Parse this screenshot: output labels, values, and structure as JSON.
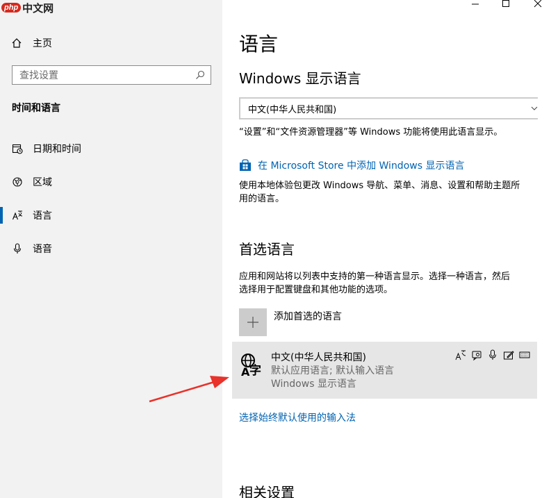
{
  "watermark": {
    "badge": "php",
    "text": "中文网"
  },
  "sidebar": {
    "home": "主页",
    "search_placeholder": "查找设置",
    "section_title": "时间和语言",
    "items": [
      {
        "label": "日期和时间",
        "icon": "calendar-clock-icon"
      },
      {
        "label": "区域",
        "icon": "globe-region-icon"
      },
      {
        "label": "语言",
        "icon": "language-icon",
        "active": true
      },
      {
        "label": "语音",
        "icon": "microphone-icon"
      }
    ]
  },
  "window_controls": [
    "minimize",
    "maximize",
    "close"
  ],
  "main": {
    "title": "语言",
    "display_language": {
      "heading": "Windows 显示语言",
      "selected": "中文(中华人民共和国)",
      "description": "“设置”和“文件资源管理器”等 Windows 功能将使用此语言显示。",
      "store_link": "在 Microsoft Store 中添加 Windows 显示语言",
      "store_description_line1": "使用本地体验包更改 Windows 导航、菜单、消息、设置和帮助主题所",
      "store_description_line2": "用的语言。"
    },
    "preferred": {
      "heading": "首选语言",
      "description_line1": "应用和网站将以列表中支持的第一种语言显示。选择一种语言，然后",
      "description_line2": "选择用于配置键盘和其他功能的选项。",
      "add_label": "添加首选的语言",
      "languages": [
        {
          "name": "中文(中华人民共和国)",
          "sub1": "默认应用语言; 默认输入语言",
          "sub2": "Windows 显示语言"
        }
      ],
      "input_method_link": "选择始终默认使用的输入法"
    },
    "related_heading": "相关设置"
  },
  "colors": {
    "accent": "#0063b1",
    "sidebar_bg": "#f2f2f2",
    "card_bg": "#e6e6e6",
    "arrow": "#e8322a"
  }
}
